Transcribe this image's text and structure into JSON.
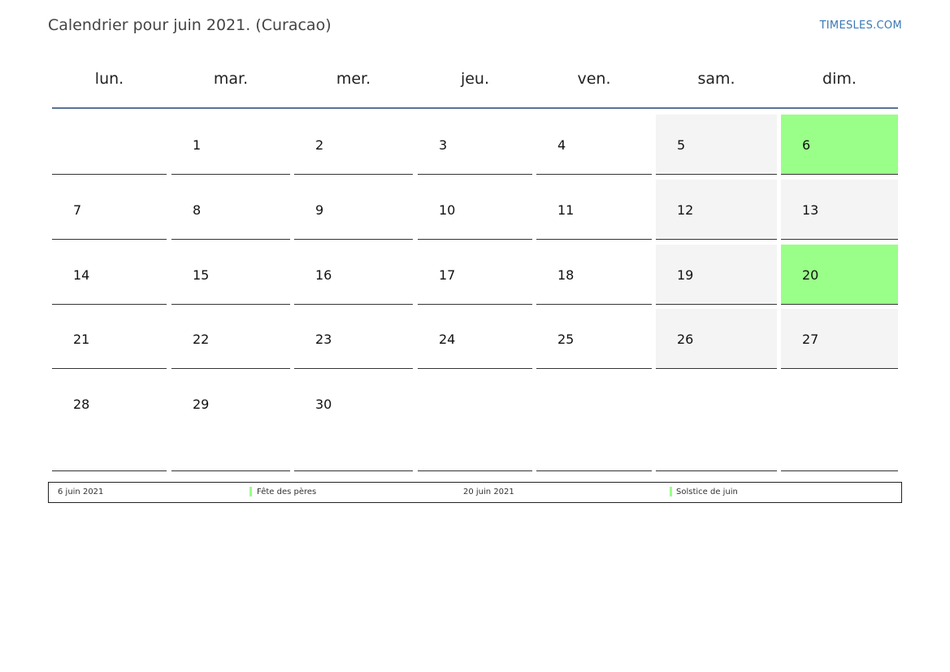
{
  "header": {
    "title": "Calendrier pour juin 2021. (Curacao)",
    "brand": "TIMESLES.COM"
  },
  "weekdays": [
    "lun.",
    "mar.",
    "mer.",
    "jeu.",
    "ven.",
    "sam.",
    "dim."
  ],
  "weeks": [
    [
      "",
      "1",
      "2",
      "3",
      "4",
      "5",
      "6"
    ],
    [
      "7",
      "8",
      "9",
      "10",
      "11",
      "12",
      "13"
    ],
    [
      "14",
      "15",
      "16",
      "17",
      "18",
      "19",
      "20"
    ],
    [
      "21",
      "22",
      "23",
      "24",
      "25",
      "26",
      "27"
    ],
    [
      "28",
      "29",
      "30",
      "",
      "",
      "",
      ""
    ]
  ],
  "holiday_days": [
    "6",
    "20"
  ],
  "colors": {
    "holiday": "#99ff88",
    "weekend": "#f4f4f4",
    "header_rule": "#5a7396",
    "brand": "#3a78b5"
  },
  "legend": [
    {
      "date": "6 juin 2021",
      "name": "Fête des pères"
    },
    {
      "date": "20 juin 2021",
      "name": "Solstice de juin"
    }
  ]
}
